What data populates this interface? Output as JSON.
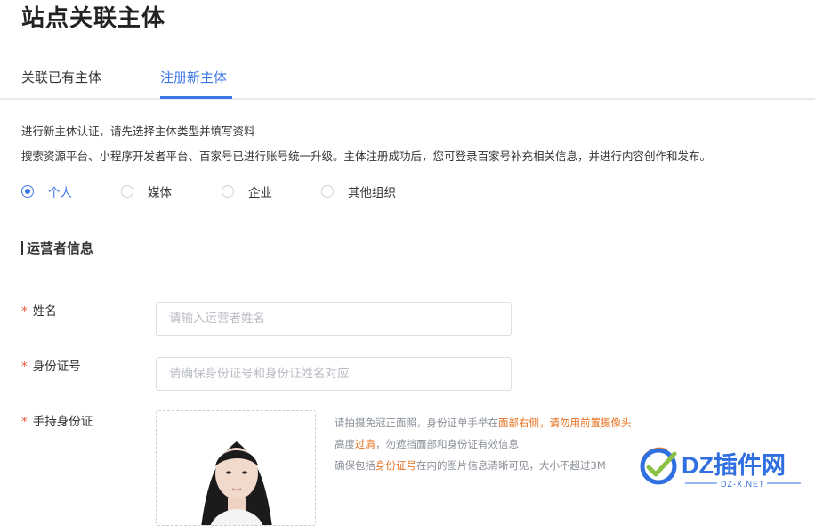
{
  "page": {
    "title": "站点关联主体"
  },
  "tabs": [
    {
      "label": "关联已有主体",
      "active": false
    },
    {
      "label": "注册新主体",
      "active": true
    }
  ],
  "description": {
    "line1": "进行新主体认证，请先选择主体类型并填写资料",
    "line2": "搜索资源平台、小程序开发者平台、百家号已进行账号统一升级。主体注册成功后，您可登录百家号补充相关信息，并进行内容创作和发布。"
  },
  "subject_types": [
    {
      "label": "个人",
      "selected": true
    },
    {
      "label": "媒体",
      "selected": false
    },
    {
      "label": "企业",
      "selected": false
    },
    {
      "label": "其他组织",
      "selected": false
    }
  ],
  "section": {
    "title": "运营者信息"
  },
  "form": {
    "required_mark": "*",
    "name": {
      "label": "姓名",
      "placeholder": "请输入运营者姓名"
    },
    "id_number": {
      "label": "身份证号",
      "placeholder": "请确保身份证号和身份证姓名对应"
    },
    "handheld_id": {
      "label": "手持身份证"
    }
  },
  "upload_hints": {
    "line1_a": "请拍摄免冠正面照，身份证单手举在",
    "line1_b": "面部右侧",
    "line1_c": "，",
    "line1_d": "请勿用前置摄像头",
    "line2_a": "高度",
    "line2_b": "过肩",
    "line2_c": "，勿遮挡面部和身份证有效信息",
    "line3_a": "确保包括",
    "line3_b": "身份证号",
    "line3_c": "在内的图片信息清晰可见，大小不超过3M"
  },
  "watermark": {
    "brand": "DZ插件网",
    "sub": "DZ-X.NET"
  },
  "colors": {
    "accent": "#3c76e6",
    "required": "#e5533c",
    "highlight": "#e8701f",
    "watermark_blue": "#2f6fe0"
  }
}
